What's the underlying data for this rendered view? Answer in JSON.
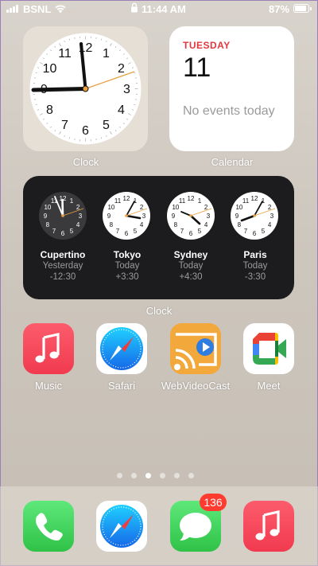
{
  "status_bar": {
    "carrier": "BSNL",
    "time": "11:44 AM",
    "battery": "87%"
  },
  "widgets": {
    "clock_label": "Clock",
    "calendar": {
      "day": "TUESDAY",
      "date": "11",
      "events": "No events today",
      "label": "Calendar"
    },
    "world_clock": {
      "label": "Clock",
      "cities": [
        {
          "name": "Cupertino",
          "day": "Yesterday",
          "offset": "-12:30"
        },
        {
          "name": "Tokyo",
          "day": "Today",
          "offset": "+3:30"
        },
        {
          "name": "Sydney",
          "day": "Today",
          "offset": "+4:30"
        },
        {
          "name": "Paris",
          "day": "Today",
          "offset": "-3:30"
        }
      ]
    }
  },
  "apps": [
    {
      "label": "Music"
    },
    {
      "label": "Safari"
    },
    {
      "label": "WebVideoCast"
    },
    {
      "label": "Meet"
    }
  ],
  "page_dots": {
    "count": 6,
    "active": 3
  },
  "dock": {
    "messages_badge": "136"
  },
  "colors": {
    "accent_red": "#e0383e",
    "badge": "#ff3b30",
    "phone_green": "#34c759",
    "music_red": "#fc3c44"
  },
  "icons": [
    "cellular-signal-icon",
    "wifi-icon",
    "lock-icon",
    "battery-icon",
    "music-icon",
    "safari-icon",
    "webvideocast-icon",
    "meet-icon",
    "phone-icon",
    "messages-icon"
  ]
}
